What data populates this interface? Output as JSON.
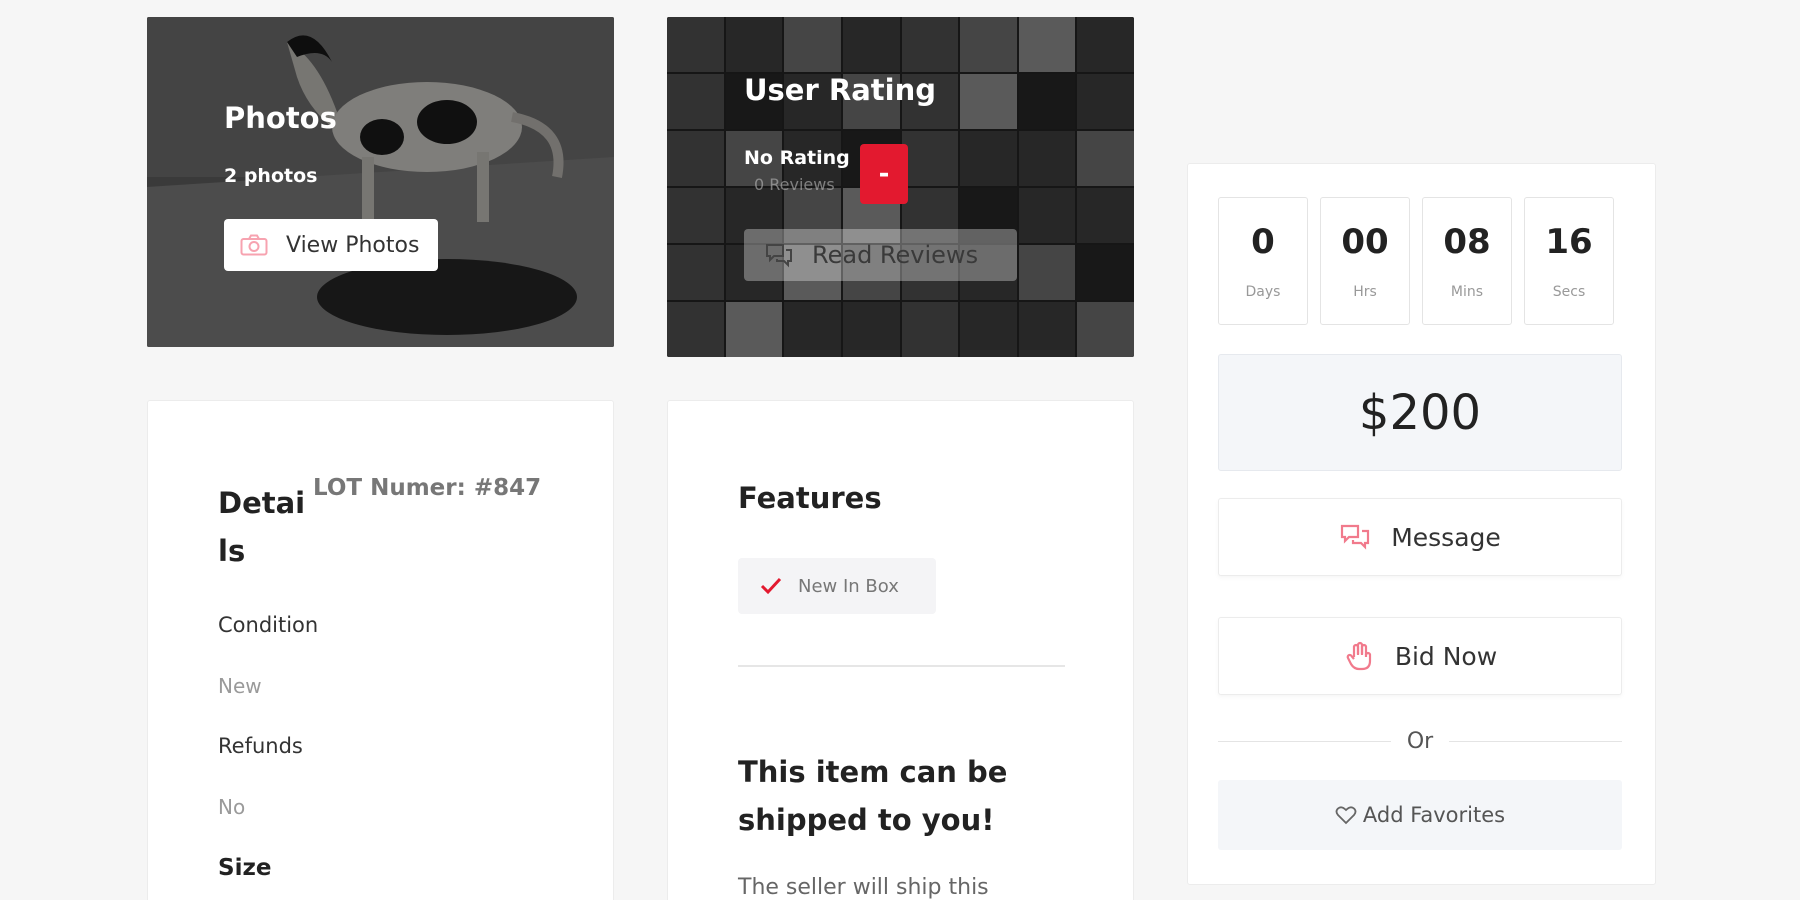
{
  "photos_card": {
    "title": "Photos",
    "count_text": "2 photos",
    "button_label": "View Photos"
  },
  "rating_card": {
    "title": "User Rating",
    "rating_text": "No Rating",
    "reviews_text": "0 Reviews",
    "badge": "-",
    "button_label": "Read Reviews"
  },
  "details": {
    "heading": "Details",
    "lot_number": "LOT Numer: #847",
    "fields": [
      {
        "label": "Condition",
        "value": "New"
      },
      {
        "label": "Refunds",
        "value": "No"
      }
    ],
    "size_label": "Size"
  },
  "features": {
    "heading": "Features",
    "chips": [
      "New In Box"
    ],
    "ship_heading": "This item can be shipped to you!",
    "ship_body": "The seller will ship this"
  },
  "bid_panel": {
    "countdown": [
      {
        "value": "0",
        "unit": "Days"
      },
      {
        "value": "00",
        "unit": "Hrs"
      },
      {
        "value": "08",
        "unit": "Mins"
      },
      {
        "value": "16",
        "unit": "Secs"
      }
    ],
    "price": "$200",
    "message_label": "Message",
    "bid_label": "Bid Now",
    "or_text": "Or",
    "favorites_label": "Add Favorites"
  },
  "colors": {
    "accent": "#e3192f",
    "accent_light": "#f17a8c",
    "background": "#f6f6f6"
  }
}
